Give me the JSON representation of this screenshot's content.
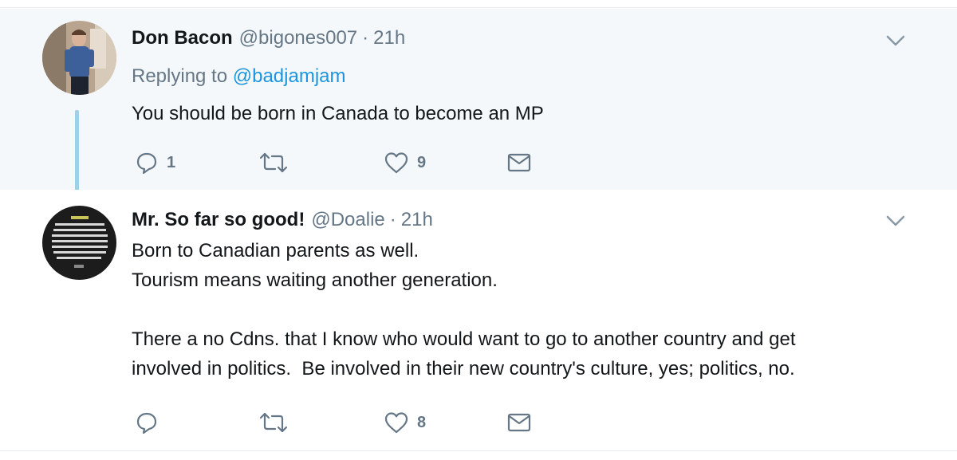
{
  "tweets": [
    {
      "display_name": "Don Bacon",
      "handle": "@bigones007",
      "separator": "·",
      "time": "21h",
      "replying_prefix": "Replying to",
      "replying_to": "@badjamjam",
      "text": "You should be born in Canada to become an MP",
      "reply_count": "1",
      "retweet_count": "",
      "like_count": "9",
      "icons": [
        "reply-icon",
        "retweet-icon",
        "heart-icon",
        "mail-icon",
        "chevron-down-icon"
      ]
    },
    {
      "display_name": "Mr. So far so good!",
      "handle": "@Doalie",
      "separator": "·",
      "time": "21h",
      "text": "Born to Canadian parents as well.\nTourism means waiting another generation.\n\nThere a no Cdns. that I know who would want to go to another country and get\ninvolved in politics.  Be involved in their new country's culture, yes; politics, no.",
      "reply_count": "",
      "retweet_count": "",
      "like_count": "8",
      "icons": [
        "reply-icon",
        "retweet-icon",
        "heart-icon",
        "mail-icon",
        "chevron-down-icon"
      ]
    }
  ],
  "colors": {
    "reply_bg": "#f5f8fa",
    "thread_line": "#9fd0ea",
    "mention": "#1b95e0",
    "secondary_text": "#657786"
  }
}
